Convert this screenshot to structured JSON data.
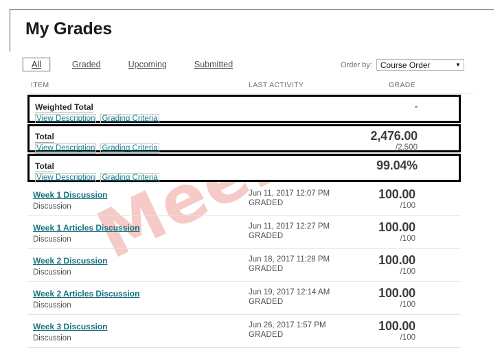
{
  "page": {
    "title": "My Grades"
  },
  "tabs": [
    {
      "label": "All",
      "selected": true
    },
    {
      "label": "Graded",
      "selected": false
    },
    {
      "label": "Upcoming",
      "selected": false
    },
    {
      "label": "Submitted",
      "selected": false
    }
  ],
  "order_by": {
    "label": "Order by:",
    "value": "Course Order",
    "caret_icon": "chevron-down-icon",
    "options": [
      "Course Order"
    ]
  },
  "columns": {
    "item": "ITEM",
    "last_activity": "LAST ACTIVITY",
    "grade": "GRADE"
  },
  "sublinks": {
    "view_description": "View Description",
    "grading_criteria": "Grading Criteria"
  },
  "colors": {
    "link": "#15707e",
    "sublink": "#1a7f8e",
    "watermark": "#f0aaa6",
    "total_border": "#000000",
    "row_divider": "#e2e2e2"
  },
  "watermark": {
    "text": "Meeloun"
  },
  "total_rows": [
    {
      "title": "Weighted Total",
      "grade": "-",
      "out_of": "",
      "is_dash": true
    },
    {
      "title": "Total",
      "grade": "2,476.00",
      "out_of": "/2,500",
      "is_dash": false
    },
    {
      "title": "Total",
      "grade": "99.04%",
      "out_of": "",
      "is_dash": false
    }
  ],
  "item_rows": [
    {
      "title": "Week 1 Discussion",
      "type": "Discussion",
      "last_activity": "Jun 11, 2017 12:07 PM",
      "status": "GRADED",
      "grade": "100.00",
      "out_of": "/100"
    },
    {
      "title": "Week 1 Articles Discussion",
      "type": "Discussion",
      "last_activity": "Jun 11, 2017 12:27 PM",
      "status": "GRADED",
      "grade": "100.00",
      "out_of": "/100"
    },
    {
      "title": "Week 2 Discussion",
      "type": "Discussion",
      "last_activity": "Jun 18, 2017 11:28 PM",
      "status": "GRADED",
      "grade": "100.00",
      "out_of": "/100"
    },
    {
      "title": "Week 2 Articles Discussion",
      "type": "Discussion",
      "last_activity": "Jun 19, 2017 12:14 AM",
      "status": "GRADED",
      "grade": "100.00",
      "out_of": "/100"
    },
    {
      "title": "Week 3 Discussion",
      "type": "Discussion",
      "last_activity": "Jun 26, 2017 1:57 PM",
      "status": "GRADED",
      "grade": "100.00",
      "out_of": "/100"
    }
  ]
}
